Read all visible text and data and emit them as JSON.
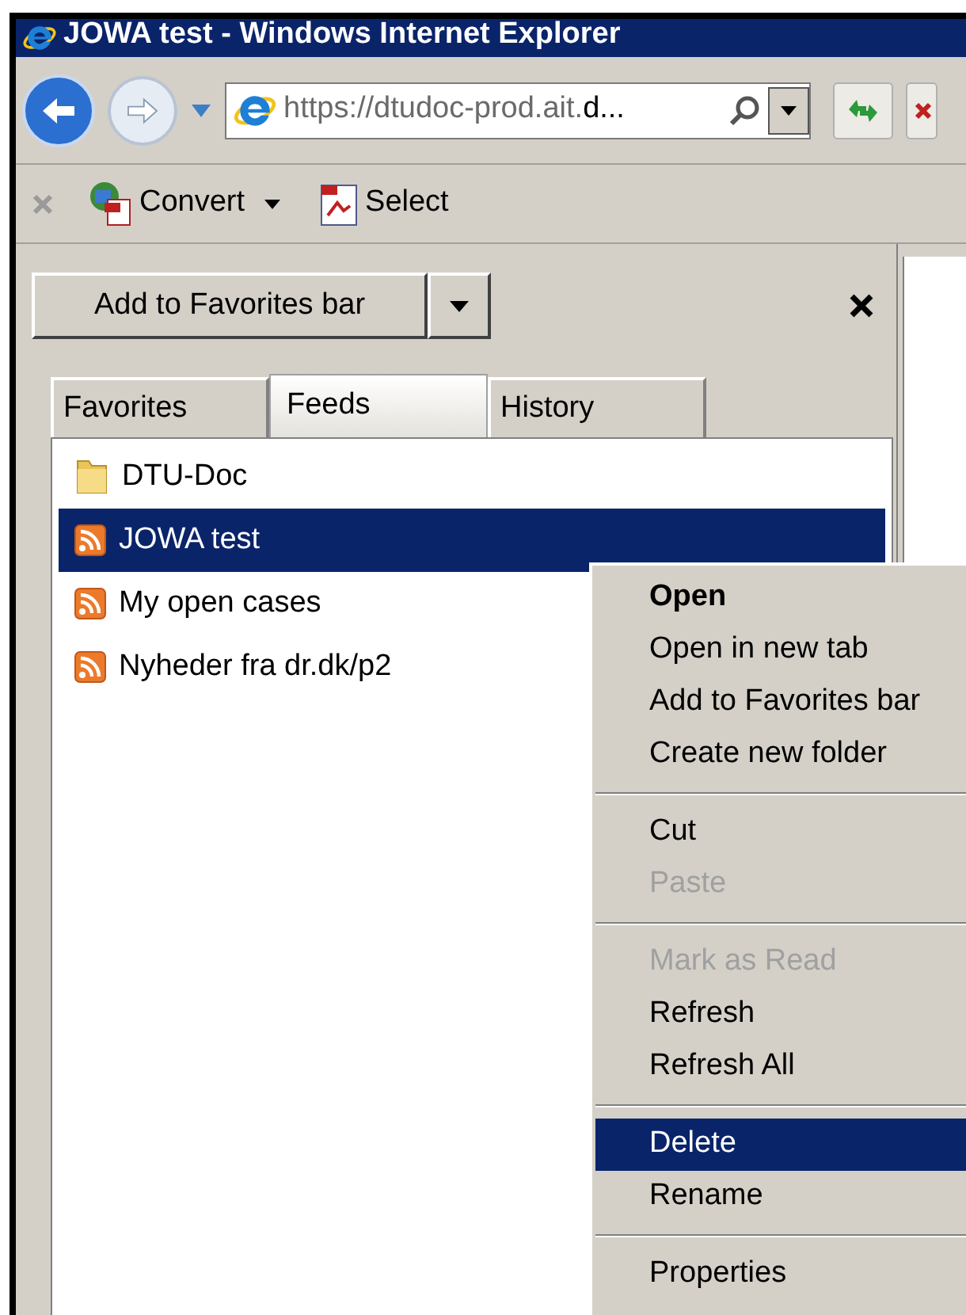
{
  "window": {
    "title": "JOWA test - Windows Internet Explorer"
  },
  "address_bar": {
    "value_grey": "https://dtudoc-prod.ait.",
    "value_dark": "d..."
  },
  "command_bar": {
    "items": [
      {
        "label": "Convert",
        "kind": "convert"
      },
      {
        "label": "Select",
        "kind": "select"
      }
    ]
  },
  "favorites_center": {
    "add_button": "Add to Favorites bar",
    "tabs": [
      {
        "label": "Favorites",
        "selected": false
      },
      {
        "label": "Feeds",
        "selected": true
      },
      {
        "label": "History",
        "selected": false
      }
    ],
    "items": [
      {
        "label": "DTU-Doc",
        "kind": "folder",
        "selected": false
      },
      {
        "label": "JOWA test",
        "kind": "feed",
        "selected": true
      },
      {
        "label": "My open cases",
        "kind": "feed",
        "selected": false
      },
      {
        "label": "Nyheder fra dr.dk/p2",
        "kind": "feed",
        "selected": false
      }
    ]
  },
  "context_menu": [
    {
      "kind": "item",
      "label": "Open",
      "default": true,
      "disabled": false,
      "selected": false
    },
    {
      "kind": "item",
      "label": "Open in new tab",
      "default": false,
      "disabled": false,
      "selected": false
    },
    {
      "kind": "item",
      "label": "Add to Favorites bar",
      "default": false,
      "disabled": false,
      "selected": false
    },
    {
      "kind": "item",
      "label": "Create new folder",
      "default": false,
      "disabled": false,
      "selected": false
    },
    {
      "kind": "separator"
    },
    {
      "kind": "item",
      "label": "Cut",
      "default": false,
      "disabled": false,
      "selected": false
    },
    {
      "kind": "item",
      "label": "Paste",
      "default": false,
      "disabled": true,
      "selected": false
    },
    {
      "kind": "separator"
    },
    {
      "kind": "item",
      "label": "Mark as Read",
      "default": false,
      "disabled": true,
      "selected": false
    },
    {
      "kind": "item",
      "label": "Refresh",
      "default": false,
      "disabled": false,
      "selected": false
    },
    {
      "kind": "item",
      "label": "Refresh All",
      "default": false,
      "disabled": false,
      "selected": false
    },
    {
      "kind": "separator"
    },
    {
      "kind": "item",
      "label": "Delete",
      "default": false,
      "disabled": false,
      "selected": true
    },
    {
      "kind": "item",
      "label": "Rename",
      "default": false,
      "disabled": false,
      "selected": false
    },
    {
      "kind": "separator"
    },
    {
      "kind": "item",
      "label": "Properties",
      "default": false,
      "disabled": false,
      "selected": false
    }
  ]
}
